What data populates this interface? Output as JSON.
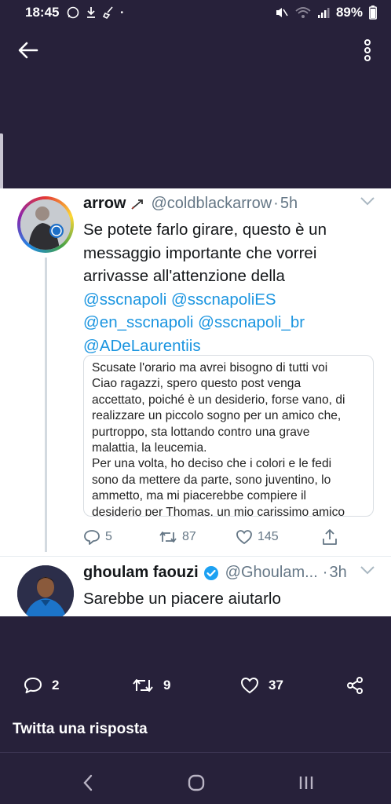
{
  "status_bar": {
    "time": "18:45",
    "left_icons": [
      "whatsapp-icon",
      "download-icon",
      "broom-icon",
      "dot-icon"
    ],
    "right_icons": [
      "mute-icon",
      "wifi-icon",
      "signal-icon"
    ],
    "battery": "89%"
  },
  "app_bar": {
    "back_icon": "arrow-left-icon",
    "more_icon": "more-vertical-icon"
  },
  "tweet1": {
    "display_name": "arrow",
    "name_icon": "arrow-emoji-icon",
    "handle": "@coldblackarrow",
    "separator": "·",
    "time": "5h",
    "text_lines": [
      "Se potete farlo girare, questo è un",
      "messaggio importante che vorrei",
      "arrivasse all'attenzione della"
    ],
    "mention_lines": [
      "@sscnapoli @sscnapoliES",
      "@en_sscnapoli @sscnapoli_br",
      "@ADeLaurentiis"
    ],
    "attached_lines": [
      "Scusate l'orario ma avrei bisogno di tutti voi",
      "Ciao ragazzi, spero questo post venga",
      "accettato, poiché è un desiderio, forse vano, di",
      "realizzare un piccolo sogno per un amico che,",
      "purtroppo, sta lottando contro una grave",
      "malattia, la leucemia.",
      "Per una volta, ho deciso che i colori e le fedi",
      "sono da mettere da parte, sono juventino, lo",
      "ammetto, ma mi piacerebbe compiere il",
      "desiderio per Thomas, un mio carissimo amico"
    ],
    "replies": "5",
    "retweets": "87",
    "likes": "145"
  },
  "tweet2": {
    "display_name": "ghoulam faouzi",
    "handle": "@Ghoulam...",
    "separator": "·",
    "time": "3h",
    "text": "Sarebbe un piacere aiutarlo"
  },
  "bottom_actions": {
    "replies": "2",
    "retweets": "9",
    "likes": "37"
  },
  "compose": {
    "placeholder": "Twitta una risposta"
  },
  "colors": {
    "background": "#27213a",
    "link": "#1b95e0",
    "muted": "#657786",
    "verified": "#1da1f2"
  }
}
